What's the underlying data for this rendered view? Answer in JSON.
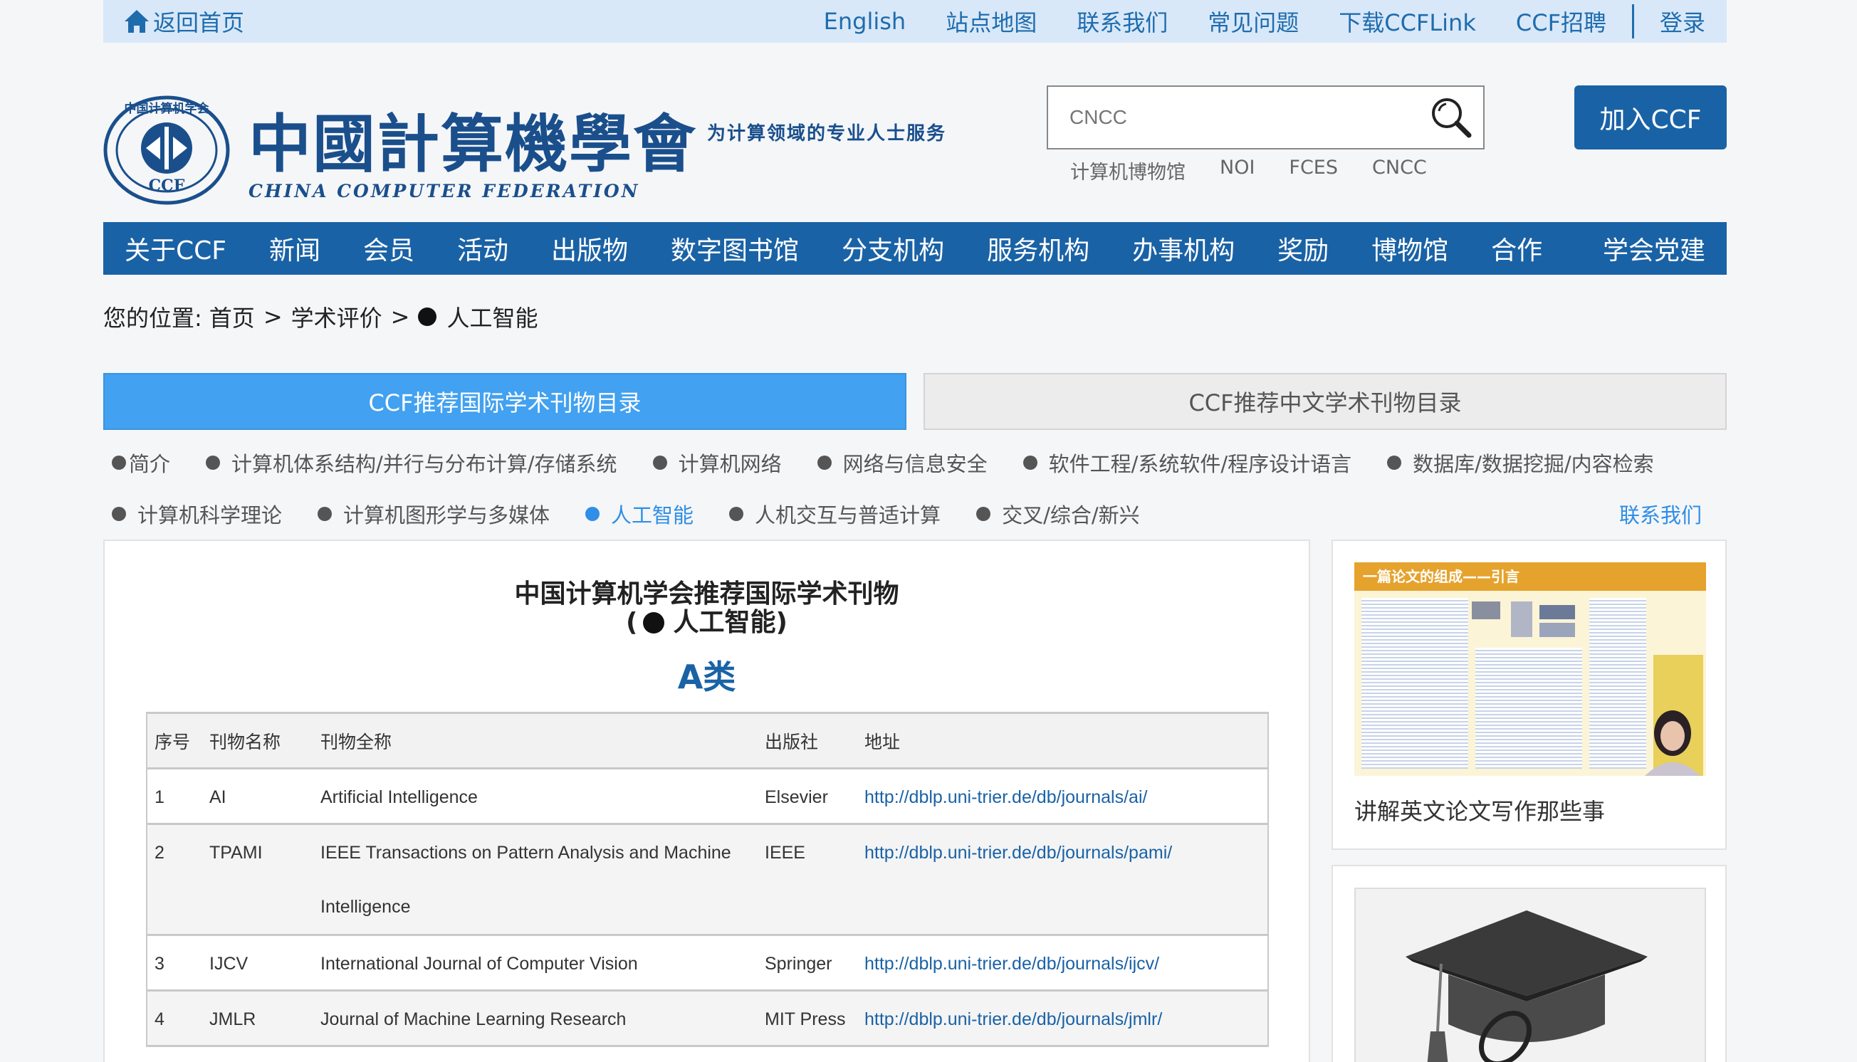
{
  "topbar": {
    "home_label": "返回首页",
    "links": [
      "English",
      "站点地图",
      "联系我们",
      "常见问题",
      "下载CCFLink",
      "CCF招聘"
    ],
    "login": "登录"
  },
  "logo": {
    "seal_text": "中国计算机学会",
    "seal_abbr": "CCF",
    "cn_name": "中國計算機學會",
    "slogan": "为计算领域的专业人士服务",
    "en_name": "CHINA COMPUTER FEDERATION"
  },
  "search": {
    "placeholder": "CNCC",
    "hot_words": [
      "计算机博物馆",
      "NOI",
      "FCES",
      "CNCC"
    ]
  },
  "join_button": "加入CCF",
  "nav": [
    "关于CCF",
    "新闻",
    "会员",
    "活动",
    "出版物",
    "数字图书馆",
    "分支机构",
    "服务机构",
    "办事机构",
    "奖励",
    "博物馆",
    "合作",
    "学会党建"
  ],
  "breadcrumb": {
    "prefix": "您的位置:",
    "items": [
      "首页",
      "学术评价"
    ],
    "sep": ">",
    "current": "人工智能"
  },
  "tabs": [
    "CCF推荐国际学术刊物目录",
    "CCF推荐中文学术刊物目录"
  ],
  "categories_row1": [
    "简介",
    "计算机体系结构/并行与分布计算/存储系统",
    "计算机网络",
    "网络与信息安全",
    "软件工程/系统软件/程序设计语言",
    "数据库/数据挖掘/内容检索"
  ],
  "categories_row2": [
    "计算机科学理论",
    "计算机图形学与多媒体",
    "人工智能",
    "人机交互与普适计算",
    "交叉/综合/新兴"
  ],
  "contact_link": "联系我们",
  "main": {
    "title": "中国计算机学会推荐国际学术刊物",
    "subtitle_open": "(",
    "subtitle_text": "人工智能)",
    "class_label": "A类",
    "columns": [
      "序号",
      "刊物名称",
      "刊物全称",
      "出版社",
      "地址"
    ],
    "rows": [
      {
        "no": "1",
        "abbr": "AI",
        "full": "Artificial Intelligence",
        "full2": "",
        "publisher": "Elsevier",
        "url": "http://dblp.uni-trier.de/db/journals/ai/"
      },
      {
        "no": "2",
        "abbr": "TPAMI",
        "full": "IEEE Transactions on Pattern Analysis and Machine",
        "full2": "Intelligence",
        "publisher": "IEEE",
        "url": "http://dblp.uni-trier.de/db/journals/pami/"
      },
      {
        "no": "3",
        "abbr": "IJCV",
        "full": "International Journal of Computer Vision",
        "full2": "",
        "publisher": "Springer",
        "url": "http://dblp.uni-trier.de/db/journals/ijcv/"
      },
      {
        "no": "4",
        "abbr": "JMLR",
        "full": "Journal of Machine Learning Research",
        "full2": "",
        "publisher": "MIT Press",
        "url": "http://dblp.uni-trier.de/db/journals/jmlr/"
      }
    ]
  },
  "sidebar": {
    "card1_thumb_header": "一篇论文的组成——引言",
    "card1_title": "讲解英文论文写作那些事"
  },
  "colors": {
    "brand_blue": "#1a62a6",
    "tab_active": "#42a1f0",
    "topbar_bg": "#d8e8f9",
    "link_blue": "#2f8fe6"
  }
}
